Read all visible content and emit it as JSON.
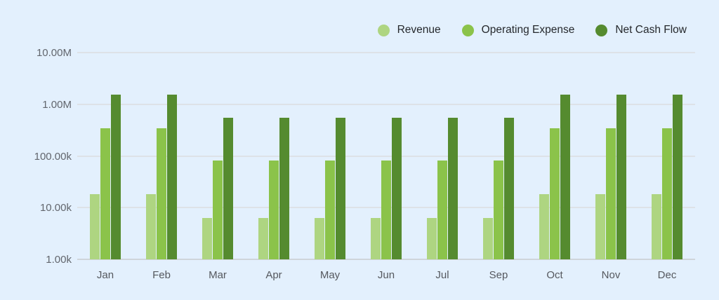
{
  "panel": {
    "background": "#E3F0FD"
  },
  "colors": {
    "background": "#E3F0FD",
    "gridline": "#DDE2E7",
    "axis_line": "#CFD5DA",
    "y_tick_label": "#62666D",
    "x_tick_label": "#55585E",
    "legend_text": "#25282C"
  },
  "chart_data": {
    "type": "bar",
    "scale": "log",
    "title": "",
    "xlabel": "",
    "ylabel": "",
    "grid": "horizontal",
    "legend_position": "top-right",
    "ylim": [
      1000,
      10000000
    ],
    "categories": [
      "Jan",
      "Feb",
      "Mar",
      "Apr",
      "May",
      "Jun",
      "Jul",
      "Sep",
      "Oct",
      "Nov",
      "Dec"
    ],
    "series": [
      {
        "name": "Revenue",
        "color": "#AED581",
        "values": [
          18000,
          18000,
          6300,
          6300,
          6300,
          6300,
          6300,
          6300,
          18000,
          18000,
          18000
        ]
      },
      {
        "name": "Operating Expense",
        "color": "#8BC34A",
        "values": [
          340000,
          340000,
          82000,
          82000,
          82000,
          82000,
          82000,
          82000,
          340000,
          340000,
          340000
        ]
      },
      {
        "name": "Net Cash Flow",
        "color": "#558B2F",
        "values": [
          1550000,
          1550000,
          540000,
          540000,
          540000,
          540000,
          540000,
          540000,
          1550000,
          1550000,
          1550000
        ]
      }
    ],
    "y_ticks": [
      {
        "label": "10.00M",
        "value": 10000000
      },
      {
        "label": "1.00M",
        "value": 1000000
      },
      {
        "label": "100.00k",
        "value": 100000
      },
      {
        "label": "10.00k",
        "value": 10000
      },
      {
        "label": "1.00k",
        "value": 1000
      }
    ]
  }
}
